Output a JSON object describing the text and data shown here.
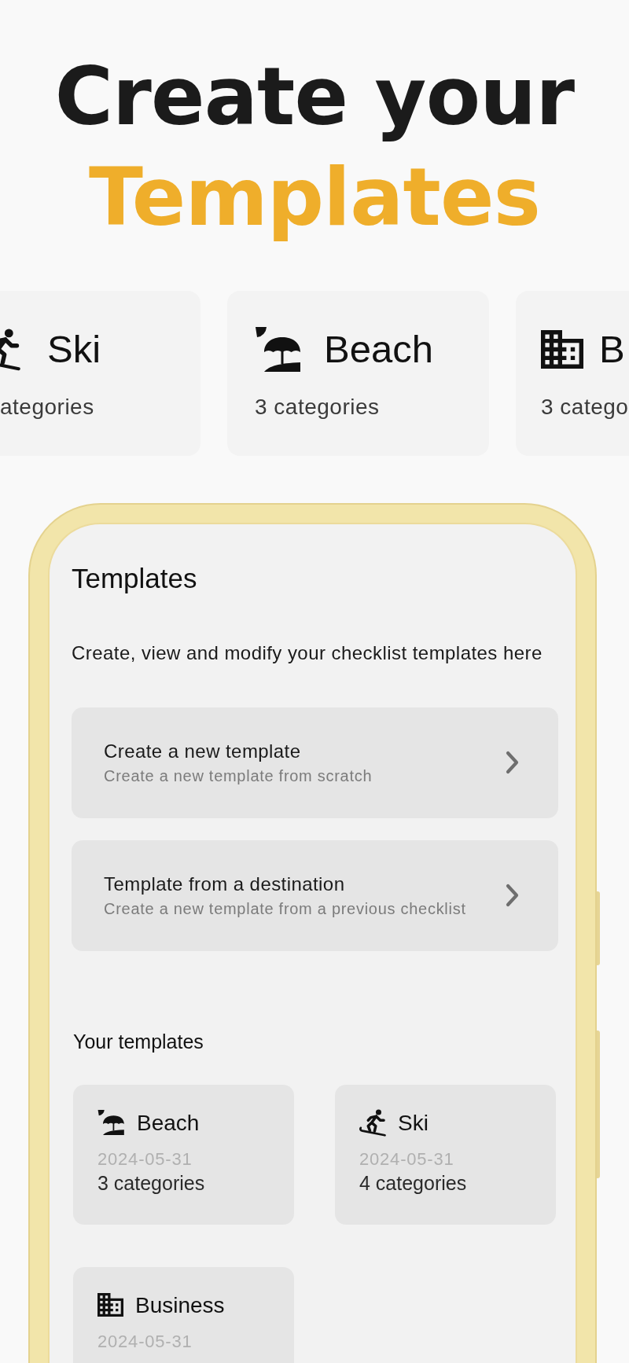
{
  "headline": {
    "text": "Create your",
    "highlight": "Templates"
  },
  "carousel": [
    {
      "kind": "ski",
      "title": "Ski",
      "subtitle": "ategories"
    },
    {
      "kind": "beach",
      "title": "Beach",
      "subtitle": "3 categories"
    },
    {
      "kind": "building",
      "title": "B",
      "subtitle": "3 catego"
    }
  ],
  "screen": {
    "title": "Templates",
    "description": "Create, view and modify your checklist templates here",
    "options": [
      {
        "title": "Create a new template",
        "subtitle": "Create a new template from scratch"
      },
      {
        "title": "Template from a destination",
        "subtitle": "Create a new template from a previous checklist"
      }
    ],
    "section_title": "Your templates",
    "templates": [
      {
        "kind": "beach",
        "name": "Beach",
        "date": "2024-05-31",
        "categories": "3 categories"
      },
      {
        "kind": "ski",
        "name": "Ski",
        "date": "2024-05-31",
        "categories": "4 categories"
      },
      {
        "kind": "building",
        "name": "Business",
        "date": "2024-05-31"
      }
    ]
  }
}
